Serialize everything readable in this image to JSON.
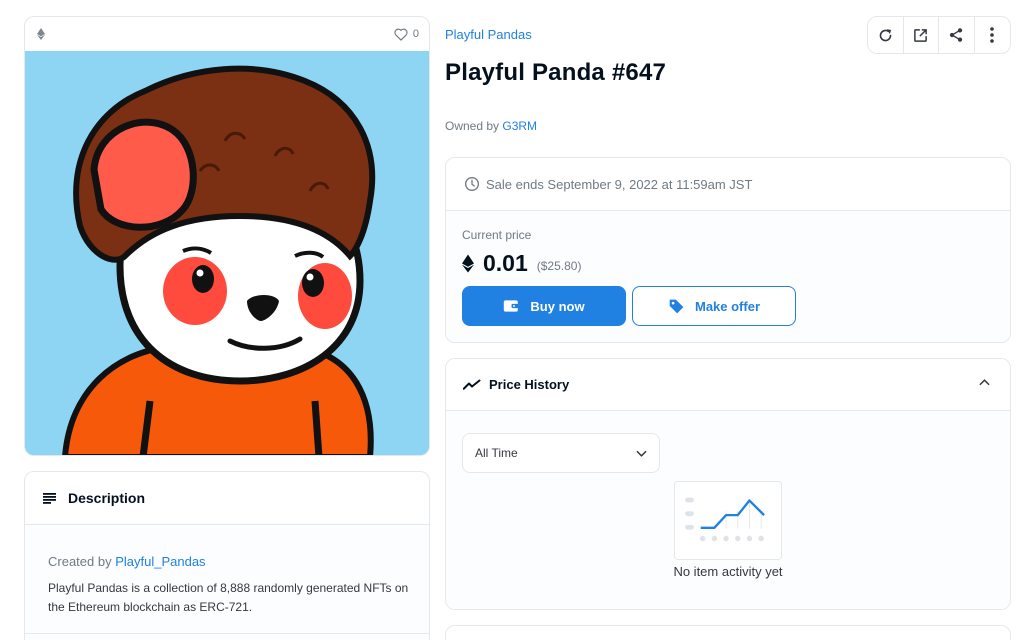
{
  "asset": {
    "favorite_count": "0"
  },
  "description": {
    "heading": "Description",
    "created_by_prefix": "Created by",
    "creator": "Playful_Pandas",
    "text": "Playful Pandas is a collection of 8,888 randomly generated NFTs on the Ethereum blockchain as ERC-721."
  },
  "header": {
    "collection": "Playful Pandas",
    "title": "Playful Panda #647",
    "owned_by_prefix": "Owned by",
    "owner": "G3RM"
  },
  "toolbar": {
    "icons": [
      "refresh-icon",
      "external-link-icon",
      "share-icon",
      "more-icon"
    ]
  },
  "sale": {
    "ends_text": "Sale ends September 9, 2022 at 11:59am JST",
    "current_price_label": "Current price",
    "price": "0.01",
    "usd": "($25.80)",
    "buy_label": "Buy now",
    "offer_label": "Make offer"
  },
  "price_history": {
    "heading": "Price History",
    "filter_selected": "All Time",
    "empty_text": "No item activity yet"
  },
  "colors": {
    "accent": "#2081e2",
    "art_background": "#8dd5f2",
    "shirt": "#f7590b",
    "hair": "#7b2f13"
  }
}
